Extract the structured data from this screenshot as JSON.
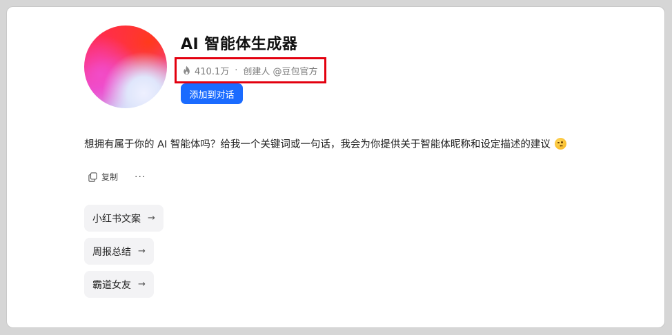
{
  "agent": {
    "name": "AI 智能体生成器",
    "heat_count": "410.1万",
    "separator": "·",
    "creator_label": "创建人 @豆包官方",
    "add_button_label": "添加到对话"
  },
  "message": {
    "text": "想拥有属于你的 AI 智能体吗？给我一个关键词或一句话，我会为你提供关于智能体昵称和设定描述的建议",
    "emoji": "wink-emoji"
  },
  "actions": {
    "copy_label": "复制",
    "more_label": "···"
  },
  "suggestions": [
    {
      "label": "小红书文案",
      "arrow": "→"
    },
    {
      "label": "周报总结",
      "arrow": "→"
    },
    {
      "label": "霸道女友",
      "arrow": "→"
    }
  ],
  "colors": {
    "accent": "#1a6bff",
    "highlight_box": "#e3000f"
  }
}
